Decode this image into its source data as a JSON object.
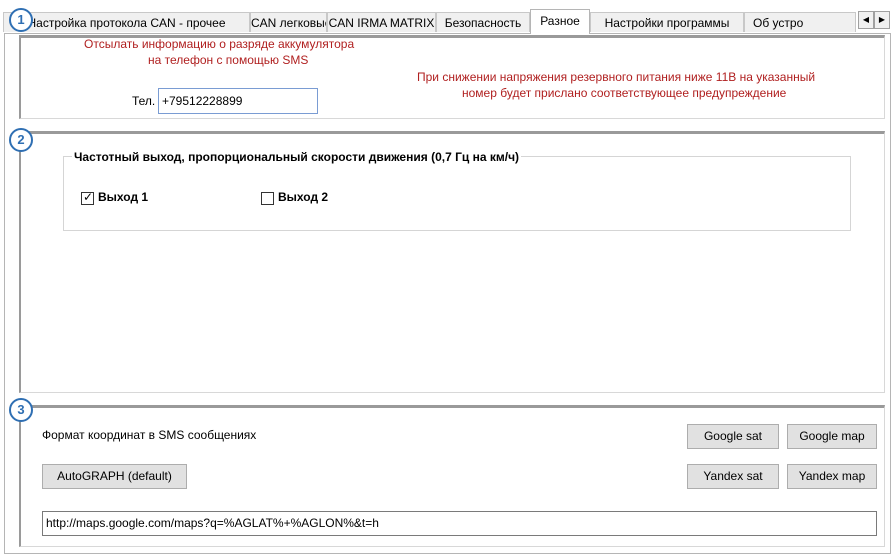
{
  "tabs": [
    {
      "label": "Настройка протокола CAN - прочее"
    },
    {
      "label": "CAN легковые"
    },
    {
      "label": "CAN IRMA MATRIX"
    },
    {
      "label": "Безопасность"
    },
    {
      "label": "Разное"
    },
    {
      "label": "Настройки программы"
    },
    {
      "label": "Об устро"
    }
  ],
  "active_tab": "Разное",
  "badges": [
    "1",
    "2",
    "3"
  ],
  "sms_section": {
    "info_line1": "Отсылать информацию о разряде аккумулятора",
    "info_line2": "на телефон с помощью SMS",
    "phone_label": "Тел.",
    "phone_value": "+79512228899",
    "warning_line1": "При снижении напряжения резервного питания ниже 11В на указанный",
    "warning_line2": "номер будет прислано соответствующее предупреждение"
  },
  "freq_section": {
    "group_title": "Частотный выход, пропорциональный скорости движения (0,7 Гц на км/ч)",
    "output1_label": "Выход 1",
    "output1_checked": true,
    "output2_label": "Выход 2",
    "output2_checked": false
  },
  "coords_section": {
    "format_label": "Формат координат в SMS сообщениях",
    "google_sat": "Google sat",
    "google_map": "Google map",
    "yandex_sat": "Yandex sat",
    "yandex_map": "Yandex map",
    "autograph_default": "AutoGRAPH (default)",
    "url_value": "http://maps.google.com/maps?q=%AGLAT%+%AGLON%&t=h"
  },
  "colors": {
    "badge": "#2f6fb3",
    "warning_text": "#b01f1f"
  }
}
